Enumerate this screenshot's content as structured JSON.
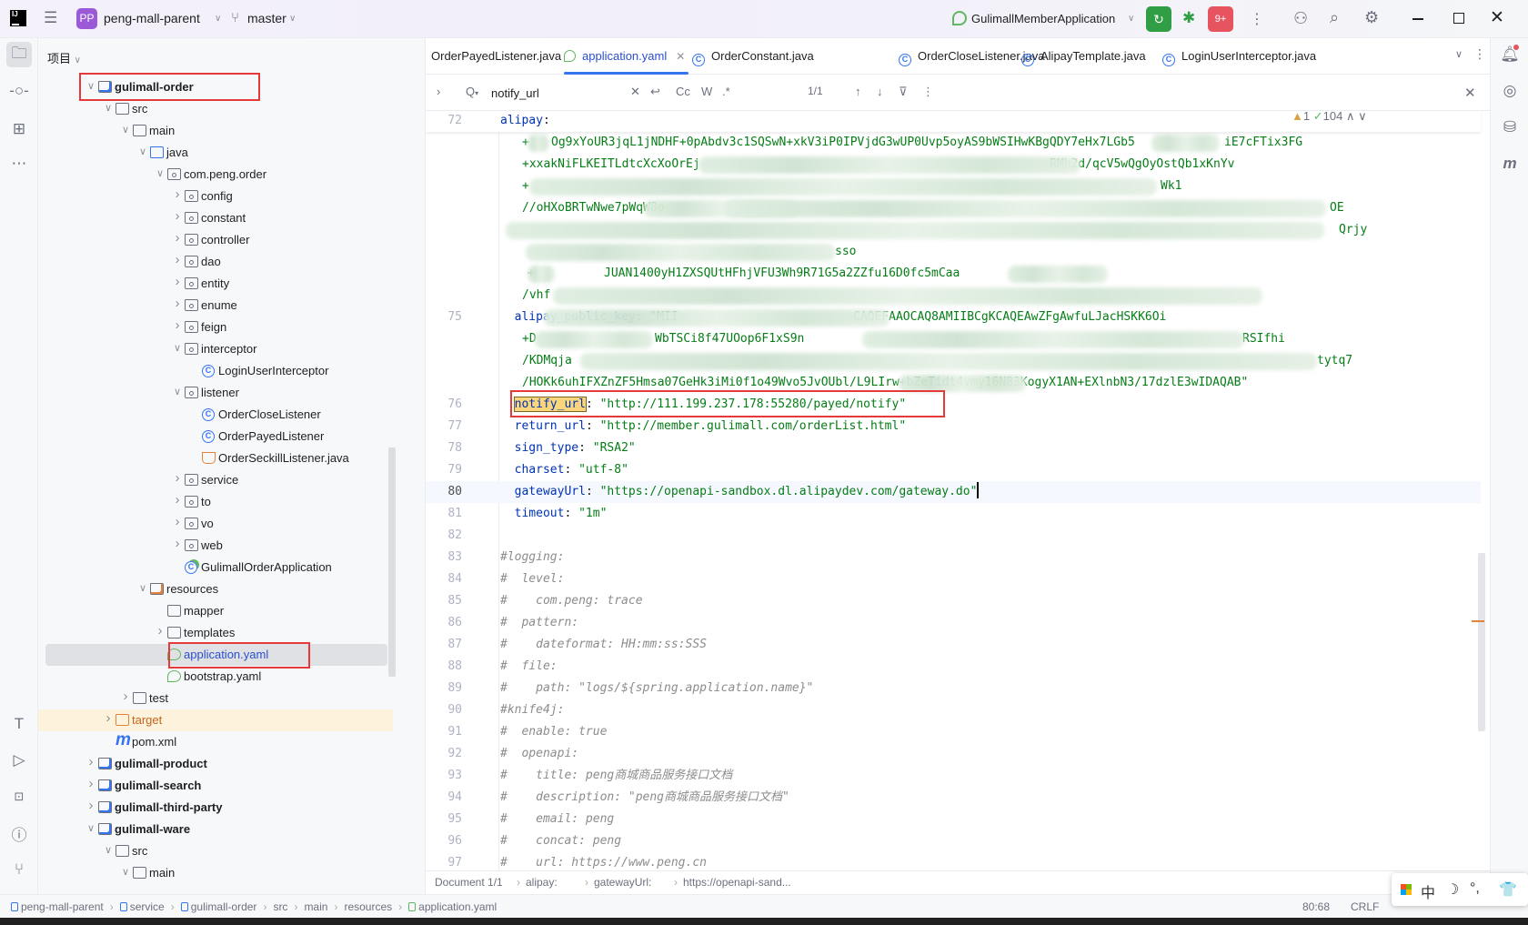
{
  "header": {
    "project_badge": "PP",
    "project_name": "peng-mall-parent",
    "branch": "master",
    "run_config": "GulimallMemberApplication",
    "notification_badge": "9+",
    "colors": {
      "run": "#2f9e44",
      "stop": "#e5545f",
      "badge": "#9b59d8"
    }
  },
  "project_panel": {
    "title": "项目",
    "tree": [
      {
        "label": "gulimall-order",
        "depth": 0,
        "chev": "down",
        "icon": "module",
        "bold": true
      },
      {
        "label": "src",
        "depth": 1,
        "chev": "down",
        "icon": "folder"
      },
      {
        "label": "main",
        "depth": 2,
        "chev": "down",
        "icon": "folder"
      },
      {
        "label": "java",
        "depth": 3,
        "chev": "down",
        "icon": "source-folder"
      },
      {
        "label": "com.peng.order",
        "depth": 4,
        "chev": "down",
        "icon": "package"
      },
      {
        "label": "config",
        "depth": 5,
        "chev": "right",
        "icon": "package"
      },
      {
        "label": "constant",
        "depth": 5,
        "chev": "right",
        "icon": "package"
      },
      {
        "label": "controller",
        "depth": 5,
        "chev": "right",
        "icon": "package"
      },
      {
        "label": "dao",
        "depth": 5,
        "chev": "right",
        "icon": "package"
      },
      {
        "label": "entity",
        "depth": 5,
        "chev": "right",
        "icon": "package"
      },
      {
        "label": "enume",
        "depth": 5,
        "chev": "right",
        "icon": "package"
      },
      {
        "label": "feign",
        "depth": 5,
        "chev": "right",
        "icon": "package"
      },
      {
        "label": "interceptor",
        "depth": 5,
        "chev": "down",
        "icon": "package"
      },
      {
        "label": "LoginUserInterceptor",
        "depth": 6,
        "chev": "",
        "icon": "class"
      },
      {
        "label": "listener",
        "depth": 5,
        "chev": "down",
        "icon": "package"
      },
      {
        "label": "OrderCloseListener",
        "depth": 6,
        "chev": "",
        "icon": "class"
      },
      {
        "label": "OrderPayedListener",
        "depth": 6,
        "chev": "",
        "icon": "class"
      },
      {
        "label": "OrderSeckillListener.java",
        "depth": 6,
        "chev": "",
        "icon": "java-file"
      },
      {
        "label": "service",
        "depth": 5,
        "chev": "right",
        "icon": "package"
      },
      {
        "label": "to",
        "depth": 5,
        "chev": "right",
        "icon": "package"
      },
      {
        "label": "vo",
        "depth": 5,
        "chev": "right",
        "icon": "package"
      },
      {
        "label": "web",
        "depth": 5,
        "chev": "right",
        "icon": "package"
      },
      {
        "label": "GulimallOrderApplication",
        "depth": 5,
        "chev": "",
        "icon": "spring-class"
      },
      {
        "label": "resources",
        "depth": 3,
        "chev": "down",
        "icon": "resources-folder"
      },
      {
        "label": "mapper",
        "depth": 4,
        "chev": "",
        "icon": "folder"
      },
      {
        "label": "templates",
        "depth": 4,
        "chev": "right",
        "icon": "folder"
      },
      {
        "label": "application.yaml",
        "depth": 4,
        "chev": "",
        "icon": "spring-yaml",
        "selected": true,
        "link": true
      },
      {
        "label": "bootstrap.yaml",
        "depth": 4,
        "chev": "",
        "icon": "spring-yaml"
      },
      {
        "label": "test",
        "depth": 2,
        "chev": "right",
        "icon": "folder"
      },
      {
        "label": "target",
        "depth": 1,
        "chev": "right",
        "icon": "excluded-folder",
        "excluded": true
      },
      {
        "label": "pom.xml",
        "depth": 1,
        "chev": "",
        "icon": "maven"
      },
      {
        "label": "gulimall-product",
        "depth": 0,
        "chev": "right",
        "icon": "module",
        "bold": true
      },
      {
        "label": "gulimall-search",
        "depth": 0,
        "chev": "right",
        "icon": "module",
        "bold": true
      },
      {
        "label": "gulimall-third-party",
        "depth": 0,
        "chev": "right",
        "icon": "module",
        "bold": true
      },
      {
        "label": "gulimall-ware",
        "depth": 0,
        "chev": "down",
        "icon": "module",
        "bold": true
      },
      {
        "label": "src",
        "depth": 1,
        "chev": "down",
        "icon": "folder"
      },
      {
        "label": "main",
        "depth": 2,
        "chev": "down",
        "icon": "folder"
      }
    ]
  },
  "tabs": [
    {
      "label": "OrderPayedListener.java",
      "icon": ""
    },
    {
      "label": "application.yaml",
      "icon": "spring-yaml",
      "active": true,
      "closable": true
    },
    {
      "label": "OrderConstant.java",
      "icon": "class"
    },
    {
      "label": "OrderCloseListener.java",
      "icon": "class"
    },
    {
      "label": "AlipayTemplate.java",
      "icon": "class"
    },
    {
      "label": "LoginUserInterceptor.java",
      "icon": "class"
    }
  ],
  "find": {
    "query": "notify_url",
    "options": [
      "Cc",
      "W",
      ".*"
    ],
    "result_count": "1/1"
  },
  "inspections": {
    "warnings": "1",
    "typos": "104"
  },
  "code_rows": [
    {
      "num": "72",
      "segs": [
        [
          "k",
          "alipay"
        ],
        [
          "p",
          ":"
        ]
      ]
    },
    {
      "frags": [
        "+",
        "Og9xYoUR3jqL1jNDHF+0pAbdv3c1SQSwN+xkV3iP0IPVjdG3wUP0Uvp5oyAS9bWSIHwKBgQDY7eHx7LGb5",
        "iE7cFTix3FG"
      ]
    },
    {
      "frags": [
        "+xxakNiFLKEITLdtcXcXoOrEj",
        "RMh2d/qcV5wQgOyOstQb1xKnYv"
      ]
    },
    {
      "frags": [
        "+",
        "Wk1"
      ]
    },
    {
      "frags": [
        "//oHXoBRTwNwe7pWqW8o",
        "OE"
      ]
    },
    {
      "frags": [
        "Qrjy"
      ]
    },
    {
      "frags": [
        "sso"
      ]
    },
    {
      "frags": [
        "+",
        "JUAN1400yH1ZXSQUtHFhjVFU3Wh9R71G5a2ZZfu16D0fc5mCaa"
      ]
    },
    {
      "frags": [
        "/vhf"
      ]
    },
    {
      "num": "75",
      "segs": [
        [
          "k",
          "alipay_public_key"
        ],
        [
          "p",
          ": "
        ],
        [
          "s",
          "\"MII"
        ]
      ],
      "frags": [
        "CAQEFAAOCAQ8AMIIBCgKCAQEAwZFgAwfuLJacHSKK6Oi"
      ]
    },
    {
      "frags": [
        "+D",
        "WbTSCi8f47UOop6F1xS9n",
        "RSIfhi"
      ]
    },
    {
      "frags": [
        "/KDMqja",
        "tytq7"
      ]
    },
    {
      "frags": [
        "/HOKk6uhIFXZnZF5Hmsa07GeHk3iMi0f1o49Wvo5JvOUbl/L9LIrw+bZeTidt4vmy16N83KogyX1AN+EXlnbN3/17dzlE3wIDAQAB\""
      ]
    },
    {
      "num": "76",
      "segs": [
        [
          "k",
          "notify_url"
        ],
        [
          "p",
          ": "
        ],
        [
          "s",
          "\"http://111.199.237.178:55280/payed/notify\""
        ]
      ],
      "match": true
    },
    {
      "num": "77",
      "segs": [
        [
          "k",
          "return_url"
        ],
        [
          "p",
          ": "
        ],
        [
          "s",
          "\"http://member.gulimall.com/orderList.html\""
        ]
      ]
    },
    {
      "num": "78",
      "segs": [
        [
          "k",
          "sign_type"
        ],
        [
          "p",
          ": "
        ],
        [
          "s",
          "\"RSA2\""
        ]
      ]
    },
    {
      "num": "79",
      "segs": [
        [
          "k",
          "charset"
        ],
        [
          "p",
          ": "
        ],
        [
          "s",
          "\"utf-8\""
        ]
      ]
    },
    {
      "num": "80",
      "segs": [
        [
          "k",
          "gatewayUrl"
        ],
        [
          "p",
          ": "
        ],
        [
          "s",
          "\"https://openapi-sandbox.dl.alipaydev.com/gateway.do\""
        ]
      ],
      "current": true
    },
    {
      "num": "81",
      "segs": [
        [
          "k",
          "timeout"
        ],
        [
          "p",
          ": "
        ],
        [
          "s",
          "\"1m\""
        ]
      ]
    },
    {
      "num": "82",
      "segs": []
    },
    {
      "num": "83",
      "segs": [
        [
          "c",
          "#logging:"
        ]
      ]
    },
    {
      "num": "84",
      "segs": [
        [
          "c",
          "#  level:"
        ]
      ]
    },
    {
      "num": "85",
      "segs": [
        [
          "c",
          "#    com.peng: trace"
        ]
      ]
    },
    {
      "num": "86",
      "segs": [
        [
          "c",
          "#  pattern:"
        ]
      ]
    },
    {
      "num": "87",
      "segs": [
        [
          "c",
          "#    dateformat: HH:mm:ss:SSS"
        ]
      ]
    },
    {
      "num": "88",
      "segs": [
        [
          "c",
          "#  file:"
        ]
      ]
    },
    {
      "num": "89",
      "segs": [
        [
          "c",
          "#    path: \"logs/${spring.application.name}\""
        ]
      ]
    },
    {
      "num": "90",
      "segs": [
        [
          "c",
          "#knife4j:"
        ]
      ]
    },
    {
      "num": "91",
      "segs": [
        [
          "c",
          "#  enable: true"
        ]
      ]
    },
    {
      "num": "92",
      "segs": [
        [
          "c",
          "#  openapi:"
        ]
      ]
    },
    {
      "num": "93",
      "segs": [
        [
          "c",
          "#    title: peng商城商品服务接口文档"
        ]
      ]
    },
    {
      "num": "94",
      "segs": [
        [
          "c",
          "#    description: \"peng商城商品服务接口文档\""
        ]
      ]
    },
    {
      "num": "95",
      "segs": [
        [
          "c",
          "#    email: peng"
        ]
      ]
    },
    {
      "num": "96",
      "segs": [
        [
          "c",
          "#    concat: peng"
        ]
      ]
    },
    {
      "num": "97",
      "segs": [
        [
          "c",
          "#    url: https://www.peng.cn"
        ]
      ]
    }
  ],
  "editor_breadcrumb": [
    "Document 1/1",
    "alipay:",
    "gatewayUrl:",
    "https://openapi-sand..."
  ],
  "status_bar": {
    "path": [
      "peng-mall-parent",
      "service",
      "gulimall-order",
      "src",
      "main",
      "resources",
      "application.yaml"
    ],
    "caret": "80:68",
    "line_ending": "CRLF"
  },
  "ime": {
    "mode": "中",
    "punct": "°,"
  }
}
